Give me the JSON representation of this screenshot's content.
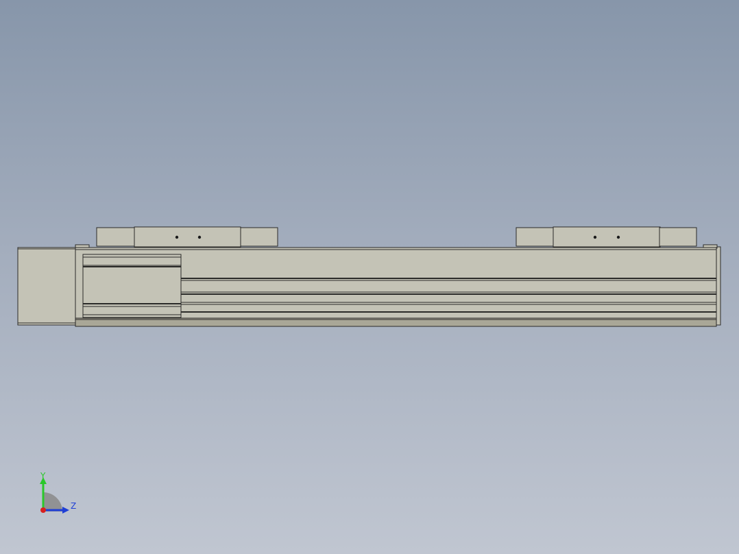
{
  "viewport": {
    "background_top": "#8796aa",
    "background_bottom": "#c0c6d1"
  },
  "model": {
    "body_color": "#c4c3b6",
    "edge_color": "#2a2a28",
    "base_strip_color": "#a9a797"
  },
  "triad": {
    "y_label": "Y",
    "z_label": "Z",
    "y_color": "#2ac82a",
    "z_color": "#1f3fd6",
    "x_color": "#d81f1f"
  }
}
